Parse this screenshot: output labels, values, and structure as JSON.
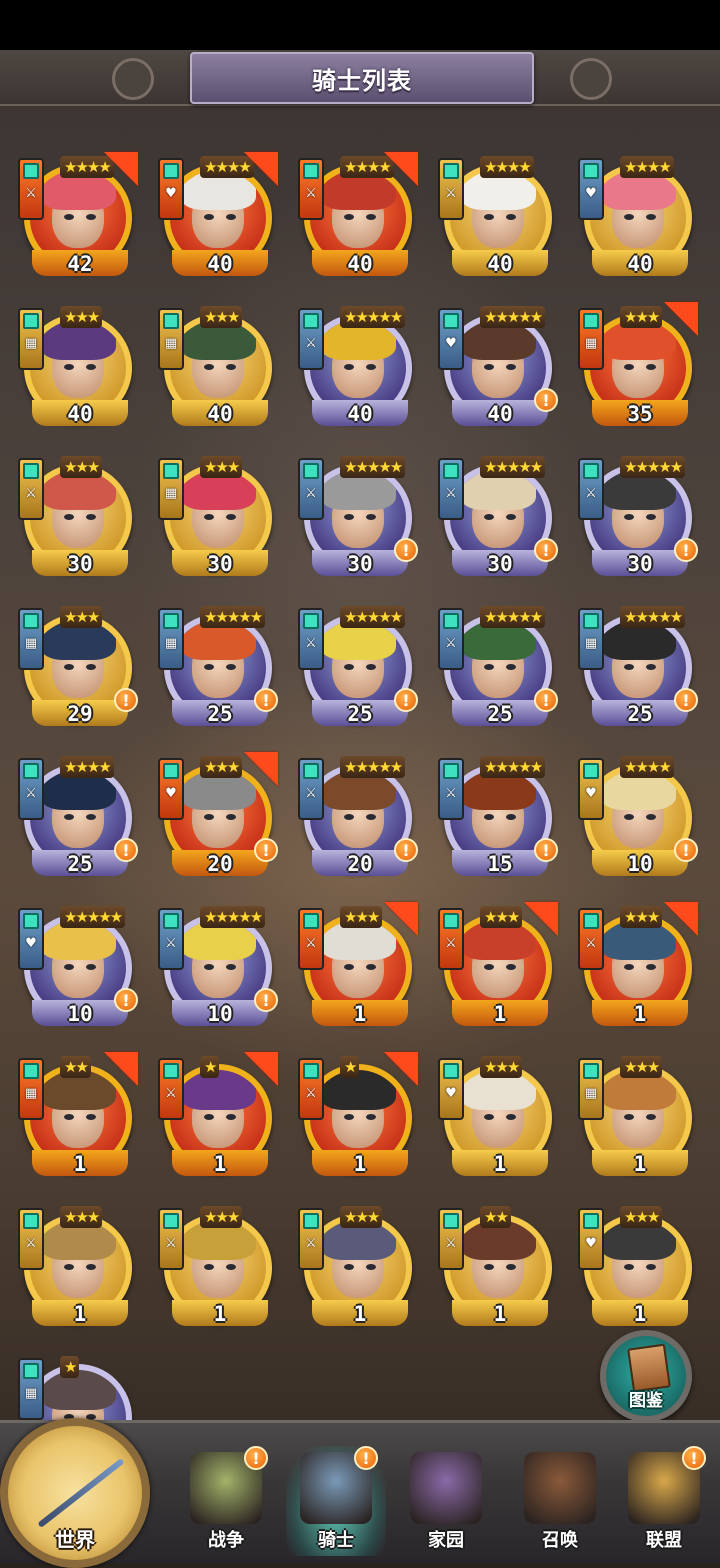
{
  "header": {
    "title": "骑士列表"
  },
  "knights": [
    {
      "level": "42",
      "frame": "orange",
      "stars": "★★★★",
      "badge": "orange",
      "role": "⚔",
      "arrow": true,
      "alert": false,
      "hair": "#e05a6a"
    },
    {
      "level": "40",
      "frame": "orange",
      "stars": "★★★★",
      "badge": "orange",
      "role": "♥",
      "arrow": true,
      "alert": false,
      "hair": "#e8e6e0"
    },
    {
      "level": "40",
      "frame": "orange",
      "stars": "★★★★",
      "badge": "orange",
      "role": "⚔",
      "arrow": true,
      "alert": false,
      "hair": "#c23a2a"
    },
    {
      "level": "40",
      "frame": "gold",
      "stars": "★★★★",
      "badge": "gold",
      "role": "⚔",
      "arrow": false,
      "alert": false,
      "hair": "#f0efe9"
    },
    {
      "level": "40",
      "frame": "gold",
      "stars": "★★★★",
      "badge": "blue",
      "role": "♥",
      "arrow": false,
      "alert": false,
      "hair": "#e8788a"
    },
    {
      "level": "40",
      "frame": "gold",
      "stars": "★★★",
      "badge": "gold",
      "role": "▦",
      "arrow": false,
      "alert": false,
      "hair": "#5b3a80"
    },
    {
      "level": "40",
      "frame": "gold",
      "stars": "★★★",
      "badge": "gold",
      "role": "▦",
      "arrow": false,
      "alert": false,
      "hair": "#3a5a3a"
    },
    {
      "level": "40",
      "frame": "purple",
      "stars": "★★★★★",
      "badge": "blue",
      "role": "⚔",
      "arrow": false,
      "alert": false,
      "hair": "#e3b52a"
    },
    {
      "level": "40",
      "frame": "purple",
      "stars": "★★★★★",
      "badge": "blue",
      "role": "♥",
      "arrow": false,
      "alert": true,
      "hair": "#5a3a2a"
    },
    {
      "level": "35",
      "frame": "orange",
      "stars": "★★★",
      "badge": "orange",
      "role": "▦",
      "arrow": true,
      "alert": false,
      "hair": "#e0502a"
    },
    {
      "level": "30",
      "frame": "gold",
      "stars": "★★★",
      "badge": "gold",
      "role": "⚔",
      "arrow": false,
      "alert": false,
      "hair": "#d0584a"
    },
    {
      "level": "30",
      "frame": "gold",
      "stars": "★★★",
      "badge": "gold",
      "role": "▦",
      "arrow": false,
      "alert": false,
      "hair": "#d8405a"
    },
    {
      "level": "30",
      "frame": "purple",
      "stars": "★★★★★",
      "badge": "blue",
      "role": "⚔",
      "arrow": false,
      "alert": true,
      "hair": "#9a9a9a"
    },
    {
      "level": "30",
      "frame": "purple",
      "stars": "★★★★★",
      "badge": "blue",
      "role": "⚔",
      "arrow": false,
      "alert": true,
      "hair": "#e0d0b0"
    },
    {
      "level": "30",
      "frame": "purple",
      "stars": "★★★★★",
      "badge": "blue",
      "role": "⚔",
      "arrow": false,
      "alert": true,
      "hair": "#3a3a3a"
    },
    {
      "level": "29",
      "frame": "gold",
      "stars": "★★★",
      "badge": "blue",
      "role": "▦",
      "arrow": false,
      "alert": true,
      "hair": "#2a3a5a"
    },
    {
      "level": "25",
      "frame": "purple",
      "stars": "★★★★★",
      "badge": "blue",
      "role": "▦",
      "arrow": false,
      "alert": true,
      "hair": "#d85a2a"
    },
    {
      "level": "25",
      "frame": "purple",
      "stars": "★★★★★",
      "badge": "blue",
      "role": "⚔",
      "arrow": false,
      "alert": true,
      "hair": "#e8d24a"
    },
    {
      "level": "25",
      "frame": "purple",
      "stars": "★★★★★",
      "badge": "blue",
      "role": "⚔",
      "arrow": false,
      "alert": true,
      "hair": "#3a6a3a"
    },
    {
      "level": "25",
      "frame": "purple",
      "stars": "★★★★★",
      "badge": "blue",
      "role": "▦",
      "arrow": false,
      "alert": true,
      "hair": "#2a2a2a"
    },
    {
      "level": "25",
      "frame": "purple",
      "stars": "★★★★",
      "badge": "blue",
      "role": "⚔",
      "arrow": false,
      "alert": true,
      "hair": "#1e2e4a"
    },
    {
      "level": "20",
      "frame": "orange",
      "stars": "★★★",
      "badge": "orange",
      "role": "♥",
      "arrow": true,
      "alert": true,
      "hair": "#8a8a8a"
    },
    {
      "level": "20",
      "frame": "purple",
      "stars": "★★★★★",
      "badge": "blue",
      "role": "⚔",
      "arrow": false,
      "alert": true,
      "hair": "#7a4a2a"
    },
    {
      "level": "15",
      "frame": "purple",
      "stars": "★★★★★",
      "badge": "blue",
      "role": "⚔",
      "arrow": false,
      "alert": true,
      "hair": "#8a3a1a"
    },
    {
      "level": "10",
      "frame": "gold",
      "stars": "★★★★",
      "badge": "gold",
      "role": "♥",
      "arrow": false,
      "alert": true,
      "hair": "#e8d8a0"
    },
    {
      "level": "10",
      "frame": "purple",
      "stars": "★★★★★",
      "badge": "blue",
      "role": "♥",
      "arrow": false,
      "alert": true,
      "hair": "#e8c04a"
    },
    {
      "level": "10",
      "frame": "purple",
      "stars": "★★★★★",
      "badge": "blue",
      "role": "⚔",
      "arrow": false,
      "alert": true,
      "hair": "#e8d04a"
    },
    {
      "level": "1",
      "frame": "orange",
      "stars": "★★★",
      "badge": "orange",
      "role": "⚔",
      "arrow": true,
      "alert": false,
      "hair": "#e0ddd5"
    },
    {
      "level": "1",
      "frame": "orange",
      "stars": "★★★",
      "badge": "orange",
      "role": "⚔",
      "arrow": true,
      "alert": false,
      "hair": "#c8402a"
    },
    {
      "level": "1",
      "frame": "orange",
      "stars": "★★★",
      "badge": "orange",
      "role": "⚔",
      "arrow": true,
      "alert": false,
      "hair": "#3a5a7a"
    },
    {
      "level": "1",
      "frame": "orange",
      "stars": "★★",
      "badge": "orange",
      "role": "▦",
      "arrow": true,
      "alert": false,
      "hair": "#6a4a2a"
    },
    {
      "level": "1",
      "frame": "orange",
      "stars": "★",
      "badge": "orange",
      "role": "⚔",
      "arrow": true,
      "alert": false,
      "hair": "#6a3a8a"
    },
    {
      "level": "1",
      "frame": "orange",
      "stars": "★",
      "badge": "orange",
      "role": "⚔",
      "arrow": true,
      "alert": false,
      "hair": "#2a2a2a"
    },
    {
      "level": "1",
      "frame": "gold",
      "stars": "★★★",
      "badge": "gold",
      "role": "♥",
      "arrow": false,
      "alert": false,
      "hair": "#e8e0d0"
    },
    {
      "level": "1",
      "frame": "gold",
      "stars": "★★★",
      "badge": "gold",
      "role": "▦",
      "arrow": false,
      "alert": false,
      "hair": "#c07a3a"
    },
    {
      "level": "1",
      "frame": "gold",
      "stars": "★★★",
      "badge": "gold",
      "role": "⚔",
      "arrow": false,
      "alert": false,
      "hair": "#b08a4a"
    },
    {
      "level": "1",
      "frame": "gold",
      "stars": "★★★",
      "badge": "gold",
      "role": "⚔",
      "arrow": false,
      "alert": false,
      "hair": "#c8a03a"
    },
    {
      "level": "1",
      "frame": "gold",
      "stars": "★★★",
      "badge": "gold",
      "role": "⚔",
      "arrow": false,
      "alert": false,
      "hair": "#5a5a7a"
    },
    {
      "level": "1",
      "frame": "gold",
      "stars": "★★",
      "badge": "gold",
      "role": "⚔",
      "arrow": false,
      "alert": false,
      "hair": "#6a3a2a"
    },
    {
      "level": "1",
      "frame": "gold",
      "stars": "★★★",
      "badge": "gold",
      "role": "♥",
      "arrow": false,
      "alert": false,
      "hair": "#3a3a3a"
    },
    {
      "level": "",
      "frame": "purple",
      "stars": "★",
      "badge": "blue",
      "role": "▦",
      "arrow": false,
      "alert": false,
      "hair": "#5a4a4a"
    }
  ],
  "codex": {
    "label": "图鉴",
    "icon": "book-icon"
  },
  "nav": {
    "world": "世界",
    "items": [
      {
        "label": "战争",
        "icon": "map-icon",
        "alert": "!",
        "active": false,
        "art": "#a3b36a"
      },
      {
        "label": "骑士",
        "icon": "knight-icon",
        "alert": "!",
        "active": true,
        "art": "#7a9ab8"
      },
      {
        "label": "家园",
        "icon": "castle-icon",
        "alert": "",
        "active": false,
        "art": "#8a6aa8"
      },
      {
        "label": "召唤",
        "icon": "train-icon",
        "alert": "",
        "active": false,
        "art": "#8a5a3a"
      },
      {
        "label": "联盟",
        "icon": "treasure-icon",
        "alert": "!",
        "active": false,
        "art": "#d8a84a"
      }
    ]
  },
  "alert_symbol": "!"
}
